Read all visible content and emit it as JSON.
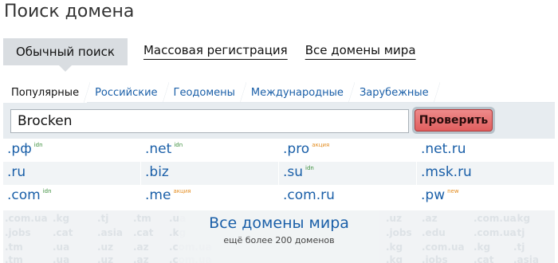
{
  "page": {
    "title": "Поиск домена"
  },
  "mode_tabs": [
    {
      "label": "Обычный поиск",
      "active": true
    },
    {
      "label": "Массовая регистрация",
      "active": false
    },
    {
      "label": "Все домены мира",
      "active": false
    }
  ],
  "zone_tabs": [
    {
      "label": "Популярные",
      "active": true
    },
    {
      "label": "Российские",
      "active": false
    },
    {
      "label": "Геодомены",
      "active": false
    },
    {
      "label": "Международные",
      "active": false
    },
    {
      "label": "Зарубежные",
      "active": false
    }
  ],
  "search": {
    "value": "Brocken",
    "button_label": "Проверить"
  },
  "zones": [
    [
      {
        "name": ".рф",
        "tag": "idn"
      },
      {
        "name": ".net",
        "tag": "idn"
      },
      {
        "name": ".pro",
        "tag": "акция"
      },
      {
        "name": ".net.ru",
        "tag": ""
      }
    ],
    [
      {
        "name": ".ru",
        "tag": ""
      },
      {
        "name": ".biz",
        "tag": ""
      },
      {
        "name": ".su",
        "tag": "idn"
      },
      {
        "name": ".msk.ru",
        "tag": ""
      }
    ],
    [
      {
        "name": ".com",
        "tag": "idn"
      },
      {
        "name": ".me",
        "tag": "акция"
      },
      {
        "name": ".com.ru",
        "tag": ""
      },
      {
        "name": ".pw",
        "tag": "new"
      }
    ]
  ],
  "world": {
    "link": "Все домены мира",
    "subtitle": "ещё более 200 доменов",
    "background_zones": [
      ".com.ua",
      ".kg",
      ".tj",
      ".tm",
      ".ua",
      ".uz",
      ".az",
      ".com.ua",
      ".kg",
      ".jobs",
      ".cat",
      ".asia",
      ".cat",
      ".kg",
      ".jobs",
      ".edu",
      ".com.ua",
      ".tj",
      ".tm",
      ".ua",
      ".uz",
      ".az",
      ".com.ua",
      ".kg"
    ]
  },
  "colors": {
    "link": "#1a5fa8",
    "button": "#e05e5e",
    "panel": "#e7ecf0",
    "idn_tag": "#3c8f3c",
    "promo_tag": "#e38b1d"
  }
}
